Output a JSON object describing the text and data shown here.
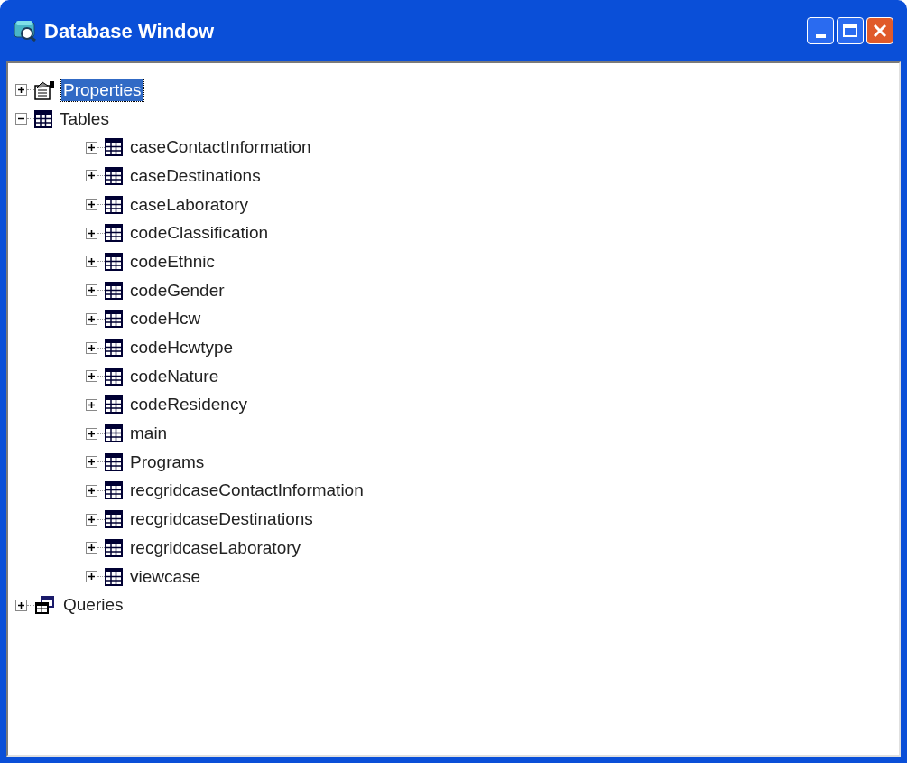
{
  "window": {
    "title": "Database Window"
  },
  "tree": [
    {
      "kind": "properties",
      "label": "Properties",
      "expanded": false,
      "selected": true
    },
    {
      "kind": "tables",
      "label": "Tables",
      "expanded": true,
      "selected": false,
      "children": [
        {
          "kind": "table",
          "label": "caseContactInformation",
          "expanded": false,
          "selected": false
        },
        {
          "kind": "table",
          "label": "caseDestinations",
          "expanded": false,
          "selected": false
        },
        {
          "kind": "table",
          "label": "caseLaboratory",
          "expanded": false,
          "selected": false
        },
        {
          "kind": "table",
          "label": "codeClassification",
          "expanded": false,
          "selected": false
        },
        {
          "kind": "table",
          "label": "codeEthnic",
          "expanded": false,
          "selected": false
        },
        {
          "kind": "table",
          "label": "codeGender",
          "expanded": false,
          "selected": false
        },
        {
          "kind": "table",
          "label": "codeHcw",
          "expanded": false,
          "selected": false
        },
        {
          "kind": "table",
          "label": "codeHcwtype",
          "expanded": false,
          "selected": false
        },
        {
          "kind": "table",
          "label": "codeNature",
          "expanded": false,
          "selected": false
        },
        {
          "kind": "table",
          "label": "codeResidency",
          "expanded": false,
          "selected": false
        },
        {
          "kind": "table",
          "label": "main",
          "expanded": false,
          "selected": false
        },
        {
          "kind": "table",
          "label": "Programs",
          "expanded": false,
          "selected": false
        },
        {
          "kind": "table",
          "label": "recgridcaseContactInformation",
          "expanded": false,
          "selected": false
        },
        {
          "kind": "table",
          "label": "recgridcaseDestinations",
          "expanded": false,
          "selected": false
        },
        {
          "kind": "table",
          "label": "recgridcaseLaboratory",
          "expanded": false,
          "selected": false
        },
        {
          "kind": "table",
          "label": "viewcase",
          "expanded": false,
          "selected": false
        }
      ]
    },
    {
      "kind": "queries",
      "label": "Queries",
      "expanded": false,
      "selected": false
    }
  ]
}
